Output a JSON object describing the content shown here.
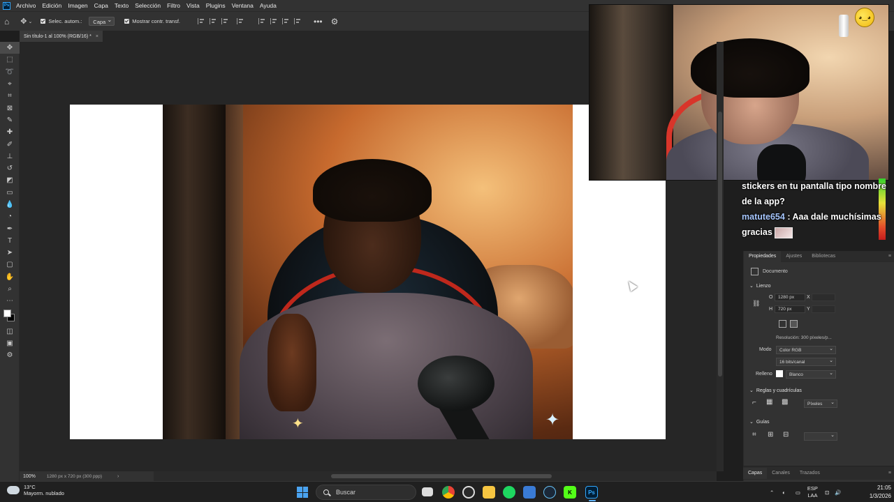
{
  "app": {
    "logo": "Ps"
  },
  "menu": [
    "Archivo",
    "Edición",
    "Imagen",
    "Capa",
    "Texto",
    "Selección",
    "Filtro",
    "Vista",
    "Plugins",
    "Ventana",
    "Ayuda"
  ],
  "options": {
    "auto_select_label": "Selec. autom.:",
    "auto_select_value": "Capa",
    "show_transform_label": "Mostrar contr. transf."
  },
  "document": {
    "tab_title": "Sin título-1 al 100% (RGB/16) *"
  },
  "status": {
    "zoom": "100%",
    "info": "1280 px x 720 px (300 ppp)"
  },
  "chat": {
    "line1": "stickers en tu pantalla tipo nombre de la app?",
    "user": "matute654",
    "line2": ": Aaa dale muchísimas gracias"
  },
  "panel": {
    "tabs": [
      "Propiedades",
      "Ajustes",
      "Bibliotecas"
    ],
    "doc_label": "Documento",
    "canvas_section": "Lienzo",
    "w_label": "O",
    "w_value": "1280 px",
    "h_label": "H",
    "h_value": "720 px",
    "x_label": "X",
    "y_label": "Y",
    "resolution": "Resolución: 300 píxeles/p...",
    "mode_label": "Modo",
    "mode_value": "Color RGB",
    "depth_value": "16 bits/canal",
    "fill_label": "Relleno",
    "fill_value": "Blanco",
    "rulers_section": "Reglas y cuadrículas",
    "units_value": "Píxeles",
    "guides_section": "Guías"
  },
  "layers_tabs": [
    "Capas",
    "Canales",
    "Trazados"
  ],
  "taskbar": {
    "weather_temp": "13°C",
    "weather_desc": "Mayorm. nublado",
    "search_placeholder": "Buscar",
    "lang": "ESP",
    "lang2": "LAA",
    "time": "21:05",
    "date": "1/3/2026"
  }
}
